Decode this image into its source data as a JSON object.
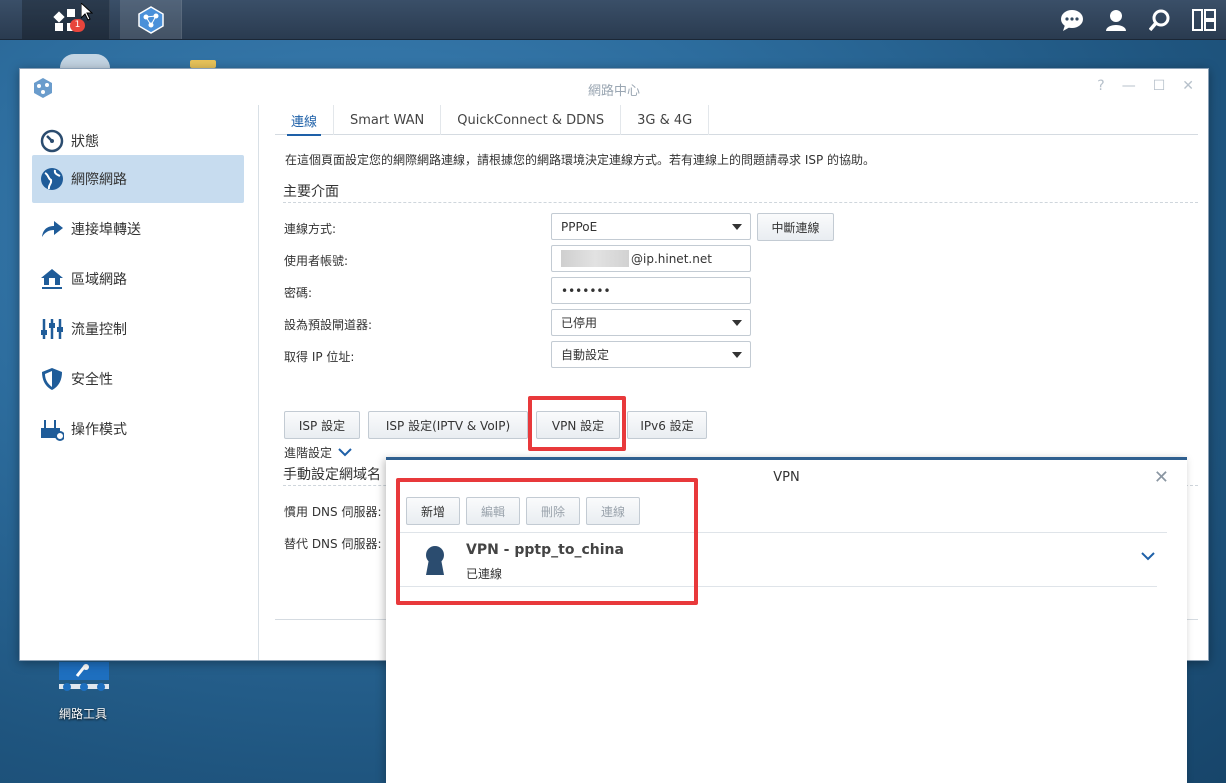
{
  "taskbar": {
    "notification_count": "1"
  },
  "window": {
    "title": "網路中心",
    "help": "?",
    "minimize": "—",
    "maximize": "☐",
    "close": "✕"
  },
  "sidebar": {
    "items": [
      {
        "label": "狀態",
        "icon": "gauge-icon"
      },
      {
        "label": "網際網路",
        "icon": "globe-icon"
      },
      {
        "label": "連接埠轉送",
        "icon": "arrow-forward-icon"
      },
      {
        "label": "區域網路",
        "icon": "home-network-icon"
      },
      {
        "label": "流量控制",
        "icon": "sliders-icon"
      },
      {
        "label": "安全性",
        "icon": "shield-icon"
      },
      {
        "label": "操作模式",
        "icon": "router-mode-icon"
      }
    ]
  },
  "tabs": [
    "連線",
    "Smart WAN",
    "QuickConnect & DDNS",
    "3G & 4G"
  ],
  "description": "在這個頁面設定您的網際網路連線，請根據您的網路環境決定連線方式。若有連線上的問題請尋求 ISP 的協助。",
  "primary_section": "主要介面",
  "form": {
    "connection_type_label": "連線方式:",
    "connection_type_value": "PPPoE",
    "disconnect_button": "中斷連線",
    "username_label": "使用者帳號:",
    "username_value": "@ip.hinet.net",
    "password_label": "密碼:",
    "password_value": "•••••••",
    "default_gateway_label": "設為預設閘道器:",
    "default_gateway_value": "已停用",
    "ip_label": "取得 IP 位址:",
    "ip_value": "自動設定",
    "advanced_label": "進階設定"
  },
  "settings_buttons": [
    "ISP 設定",
    "ISP 設定(IPTV & VoIP)",
    "VPN 設定",
    "IPv6 設定"
  ],
  "dns": {
    "section": "手動設定網域名",
    "preferred_label": "慣用 DNS 伺服器:",
    "alternate_label": "替代 DNS 伺服器:"
  },
  "desktop_icon_label": "網路工具",
  "vpn_dialog": {
    "title": "VPN",
    "close": "✕",
    "buttons": [
      "新增",
      "編輯",
      "刪除",
      "連線"
    ],
    "entry": {
      "name": "VPN - pptp_to_china",
      "status": "已連線"
    }
  },
  "colors": {
    "accent": "#1e60a8",
    "highlight_box": "#e8393b",
    "active_sidebar": "#c7dcef"
  }
}
